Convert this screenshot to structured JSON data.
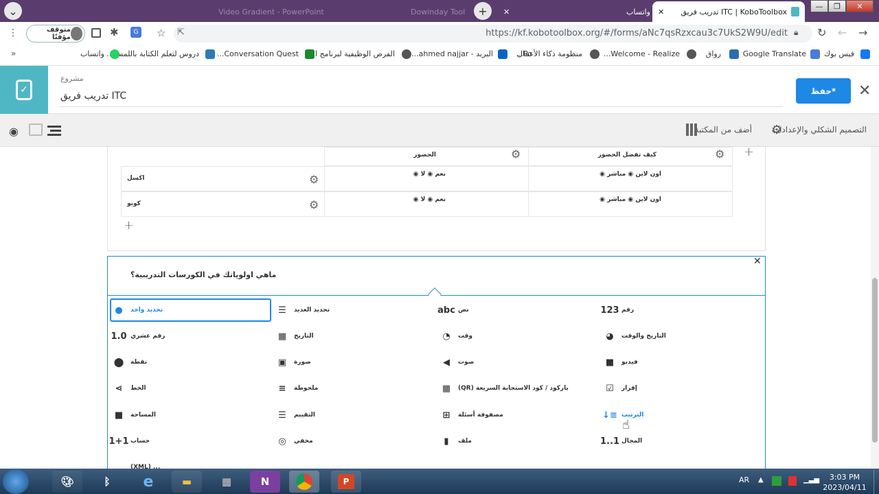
{
  "browser": {
    "tabs": [
      {
        "label": "Video Gradient - PowerPoint",
        "state": "dim"
      },
      {
        "label": "Dowinday Tool",
        "state": "dim"
      },
      {
        "label": "واتساب",
        "state": "inactive"
      },
      {
        "label": "ITC | KoboToolbox تدريب فريق",
        "state": "active"
      }
    ],
    "url": "https://kf.kobotoolbox.org/#/forms/aNc7qsRzxcau3c7UkS2W9U/edit",
    "profile_label": "متوقف مؤقتًا",
    "new_tab": "+",
    "bookmarks": [
      "فيس بوك",
      "Google Translate",
      "رواق",
      "Welcome - Realize...",
      "منظومة ذكاء الأعمال",
      "Po...",
      "البريد - ahmed najjar...",
      "الفرص الوظيفية لبرنامج ا...",
      "Conversation Quest...",
      "دروس لتعلم الكتابة باللمس...",
      "واتساب"
    ],
    "bookmarks_more": "»"
  },
  "kobo": {
    "project_label": "مشروع",
    "project_name": "ITC تدريب فريق",
    "save_label": "حفظ*",
    "settings_label": "التصميم الشكلي والإعدادات",
    "library_label": "أضف من المكتبة"
  },
  "matrix": {
    "col_headers": [
      "كيف تفضل الحضور",
      "الحضور"
    ],
    "rows": [
      {
        "label": "اكسل",
        "col1": "اون لاين ◉ مباشر ◉",
        "col2": "نعم ◉ لا ◉"
      },
      {
        "label": "كوبو",
        "col1": "اون لاين ◉ مباشر ◉",
        "col2": "نعم ◉ لا ◉"
      }
    ]
  },
  "question": {
    "title": "ماهي اولوياتك في الكورسات التدريبية؟",
    "types": [
      {
        "label": "تحديد واحد",
        "icon": "●"
      },
      {
        "label": "تحديد العديد",
        "icon": "☰"
      },
      {
        "label": "نص",
        "icon": "abc"
      },
      {
        "label": "رقم",
        "icon": "123"
      },
      {
        "label": "رقم عشري",
        "icon": "1.0"
      },
      {
        "label": "التاريخ",
        "icon": "▦"
      },
      {
        "label": "وقت",
        "icon": "◔"
      },
      {
        "label": "التاريخ والوقت",
        "icon": "◕"
      },
      {
        "label": "نقطة",
        "icon": "⬤"
      },
      {
        "label": "صورة",
        "icon": "▣"
      },
      {
        "label": "صوت",
        "icon": "◀"
      },
      {
        "label": "فيديو",
        "icon": "■"
      },
      {
        "label": "الخط",
        "icon": "⋖"
      },
      {
        "label": "ملحوظة",
        "icon": "≡"
      },
      {
        "label": "باركود / كود الاستجابة السريعة (QR)",
        "icon": "▦"
      },
      {
        "label": "إقرار",
        "icon": "☑"
      },
      {
        "label": "المساحة",
        "icon": "■"
      },
      {
        "label": "التقييم",
        "icon": "☰"
      },
      {
        "label": "مصفوفة أسئلة",
        "icon": "⊞"
      },
      {
        "label": "الترتيب",
        "icon": "↓≡"
      },
      {
        "label": "حساب",
        "icon": "1+1"
      },
      {
        "label": "مخفي",
        "icon": "◎"
      },
      {
        "label": "ملف",
        "icon": "▮"
      },
      {
        "label": "المجال",
        "icon": "1..1"
      }
    ],
    "partial_label": "(XML) ..."
  },
  "taskbar": {
    "time": "3:03 PM",
    "date": "2023/04/11",
    "lang": "AR"
  },
  "colors": {
    "brand": "#4fb7c4",
    "accent": "#1e88e5"
  }
}
